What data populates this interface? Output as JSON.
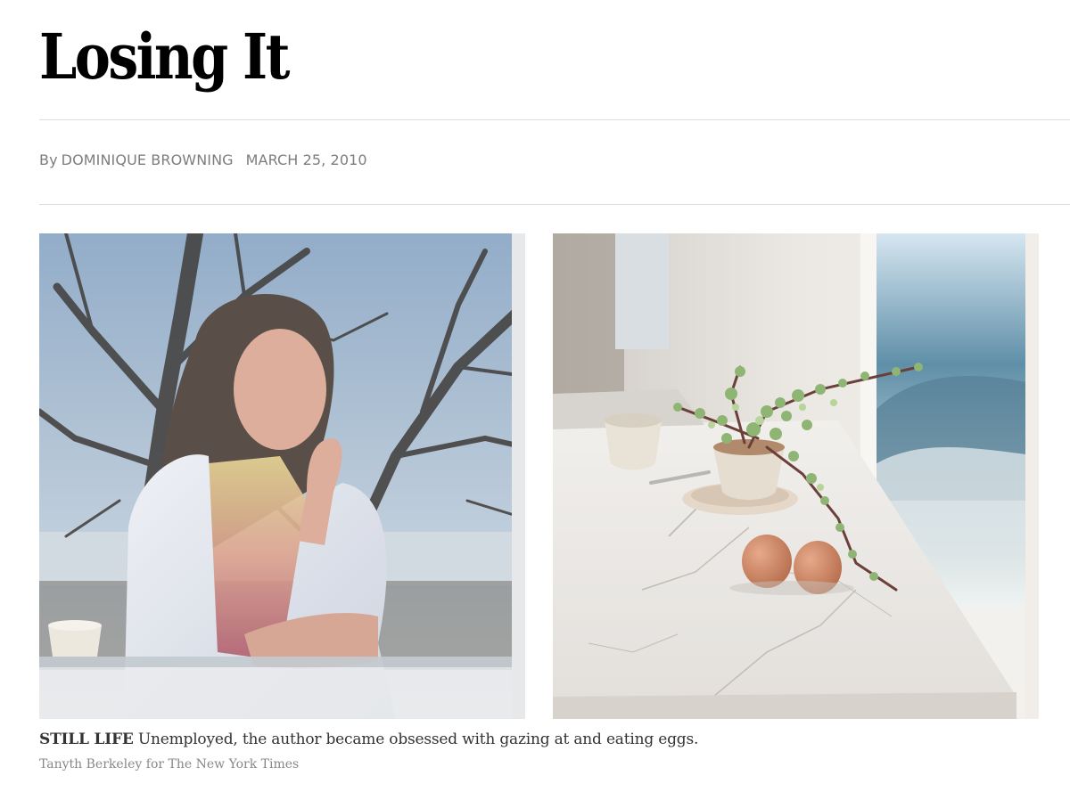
{
  "article": {
    "headline": "Losing It",
    "byline_prefix": "By",
    "author": "DOMINIQUE BROWNING",
    "date": "MARCH 25, 2010"
  },
  "figure": {
    "caption_kicker": "STILL LIFE",
    "caption_text": "Unemployed, the author became obsessed with gazing at and eating eggs.",
    "credit": "Tanyth Berkeley for The New York Times"
  },
  "colors": {
    "byline": "#7d7d7d",
    "rule": "#dcdcdc",
    "caption": "#333333",
    "credit": "#888888"
  }
}
